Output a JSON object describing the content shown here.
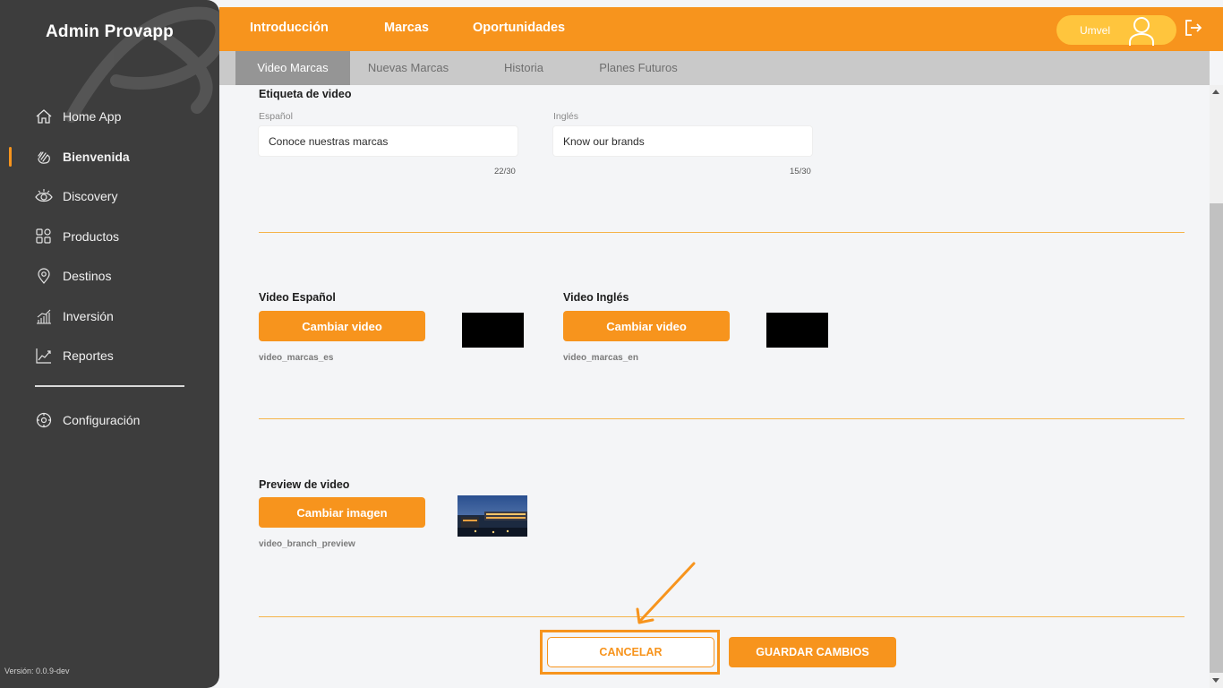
{
  "sidebar": {
    "title": "Admin Provapp",
    "items": [
      {
        "label": "Home App",
        "icon": "home-icon"
      },
      {
        "label": "Bienvenida",
        "icon": "waving-hand-icon",
        "active": true
      },
      {
        "label": "Discovery",
        "icon": "eye-icon"
      },
      {
        "label": "Productos",
        "icon": "grid-shapes-icon"
      },
      {
        "label": "Destinos",
        "icon": "map-pin-icon"
      },
      {
        "label": "Inversión",
        "icon": "bar-chart-icon"
      },
      {
        "label": "Reportes",
        "icon": "line-chart-icon"
      }
    ],
    "settings": {
      "label": "Configuración",
      "icon": "gear-icon"
    },
    "version": "Versión: 0.0.9-dev"
  },
  "topbar": {
    "tabs": [
      "Introducción",
      "Marcas",
      "Oportunidades"
    ],
    "active_tab": "Marcas",
    "user_name": "Umvel",
    "accent": "#f7941d"
  },
  "subtabs": {
    "items": [
      "Video Marcas",
      "Nuevas Marcas",
      "Historia",
      "Planes Futuros"
    ],
    "active": "Video Marcas"
  },
  "label_section": {
    "title": "Etiqueta de video",
    "spanish": {
      "label": "Español",
      "value": "Conoce nuestras marcas",
      "counter": "22/30"
    },
    "english": {
      "label": "Inglés",
      "value": "Know our brands",
      "counter": "15/30"
    }
  },
  "video_section": {
    "spanish": {
      "title": "Video Español",
      "button": "Cambiar video",
      "filename": "video_marcas_es"
    },
    "english": {
      "title": "Video Inglés",
      "button": "Cambiar video",
      "filename": "video_marcas_en"
    }
  },
  "preview_section": {
    "title": "Preview de video",
    "button": "Cambiar imagen",
    "filename": "video_branch_preview"
  },
  "actions": {
    "cancel": "CANCELAR",
    "save": "GUARDAR CAMBIOS"
  }
}
